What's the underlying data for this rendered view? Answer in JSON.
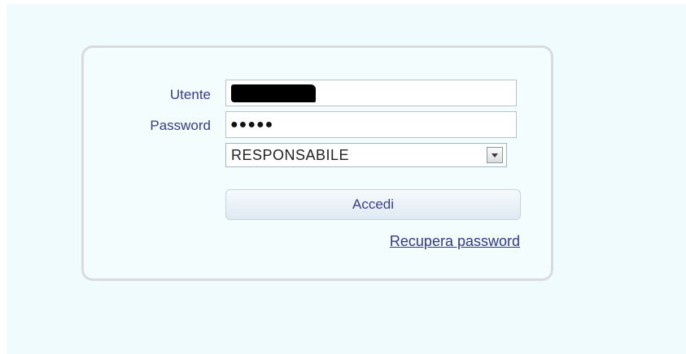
{
  "login": {
    "username_label": "Utente",
    "username_value": "",
    "password_label": "Password",
    "password_masked": "●●●●●",
    "role_selected": "RESPONSABILE",
    "submit_label": "Accedi",
    "recover_link": "Recupera password"
  },
  "icons": {
    "select_arrow": "chevron-down-icon"
  },
  "colors": {
    "page_background": "#f0fbfd",
    "label_text": "#333d8f",
    "link_text": "#30378e",
    "box_border": "#d9dcdc"
  }
}
